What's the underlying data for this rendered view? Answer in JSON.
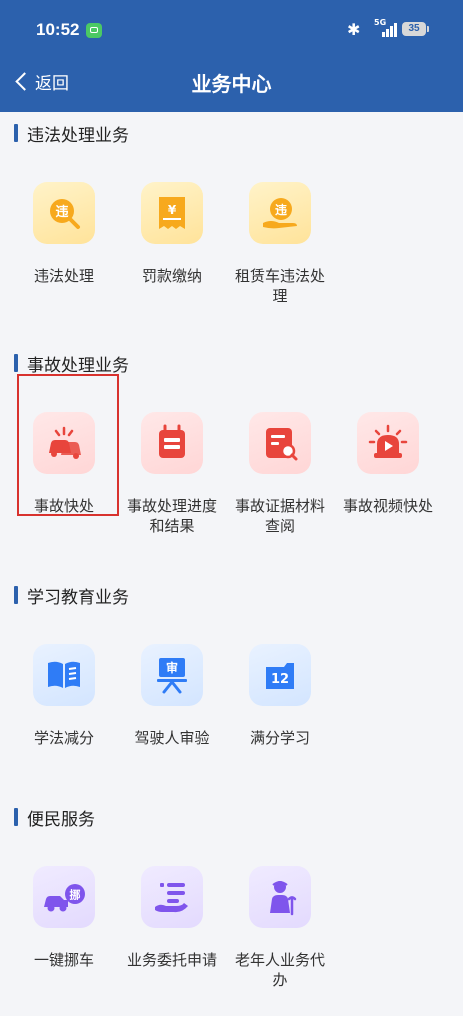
{
  "status_bar": {
    "time": "10:52",
    "network": "5G",
    "battery": "35"
  },
  "nav": {
    "back_label": "返回",
    "title": "业务中心"
  },
  "colors": {
    "header_bg": "#2c61ad",
    "highlight_border": "#d8322e"
  },
  "sections": [
    {
      "title": "违法处理业务",
      "items": [
        {
          "label": "违法处理",
          "icon": "violation-search-icon"
        },
        {
          "label": "罚款缴纳",
          "icon": "fine-receipt-icon"
        },
        {
          "label": "租赁车违法处理",
          "icon": "rental-violation-icon"
        }
      ]
    },
    {
      "title": "事故处理业务",
      "items": [
        {
          "label": "事故快处",
          "icon": "car-crash-icon",
          "highlighted": true
        },
        {
          "label": "事故处理进度和结果",
          "icon": "calendar-progress-icon"
        },
        {
          "label": "事故证据材料查阅",
          "icon": "document-search-icon"
        },
        {
          "label": "事故视频快处",
          "icon": "alarm-video-icon"
        }
      ]
    },
    {
      "title": "学习教育业务",
      "items": [
        {
          "label": "学法减分",
          "icon": "open-book-icon"
        },
        {
          "label": "驾驶人审验",
          "icon": "review-easel-icon",
          "icon_text": "审"
        },
        {
          "label": "满分学习",
          "icon": "calendar-12-icon",
          "icon_text": "12"
        }
      ]
    },
    {
      "title": "便民服务",
      "items": [
        {
          "label": "一键挪车",
          "icon": "move-car-icon",
          "icon_text": "挪"
        },
        {
          "label": "业务委托申请",
          "icon": "delegate-list-icon"
        },
        {
          "label": "老年人业务代办",
          "icon": "elderly-person-icon"
        }
      ]
    }
  ]
}
